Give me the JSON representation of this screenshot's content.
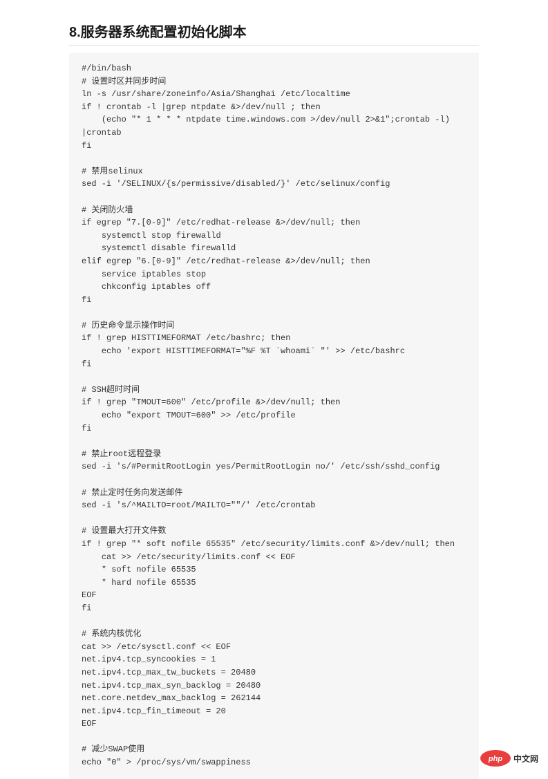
{
  "heading": "8.服务器系统配置初始化脚本",
  "code": "#/bin/bash\n# 设置时区并同步时间\nln -s /usr/share/zoneinfo/Asia/Shanghai /etc/localtime\nif ! crontab -l |grep ntpdate &>/dev/null ; then\n    (echo \"* 1 * * * ntpdate time.windows.com >/dev/null 2>&1\";crontab -l) |crontab\nfi\n\n# 禁用selinux\nsed -i '/SELINUX/{s/permissive/disabled/}' /etc/selinux/config\n\n# 关闭防火墙\nif egrep \"7.[0-9]\" /etc/redhat-release &>/dev/null; then\n    systemctl stop firewalld\n    systemctl disable firewalld\nelif egrep \"6.[0-9]\" /etc/redhat-release &>/dev/null; then\n    service iptables stop\n    chkconfig iptables off\nfi\n\n# 历史命令显示操作时间\nif ! grep HISTTIMEFORMAT /etc/bashrc; then\n    echo 'export HISTTIMEFORMAT=\"%F %T `whoami` \"' >> /etc/bashrc\nfi\n\n# SSH超时时间\nif ! grep \"TMOUT=600\" /etc/profile &>/dev/null; then\n    echo \"export TMOUT=600\" >> /etc/profile\nfi\n\n# 禁止root远程登录\nsed -i 's/#PermitRootLogin yes/PermitRootLogin no/' /etc/ssh/sshd_config\n\n# 禁止定时任务向发送邮件\nsed -i 's/^MAILTO=root/MAILTO=\"\"/' /etc/crontab\n\n# 设置最大打开文件数\nif ! grep \"* soft nofile 65535\" /etc/security/limits.conf &>/dev/null; then\n    cat >> /etc/security/limits.conf << EOF\n    * soft nofile 65535\n    * hard nofile 65535\nEOF\nfi\n\n# 系统内核优化\ncat >> /etc/sysctl.conf << EOF\nnet.ipv4.tcp_syncookies = 1\nnet.ipv4.tcp_max_tw_buckets = 20480\nnet.ipv4.tcp_max_syn_backlog = 20480\nnet.core.netdev_max_backlog = 262144\nnet.ipv4.tcp_fin_timeout = 20\nEOF\n\n# 减少SWAP使用\necho \"0\" > /proc/sys/vm/swappiness",
  "watermark": {
    "label": "中文网",
    "badge_text": "php"
  }
}
